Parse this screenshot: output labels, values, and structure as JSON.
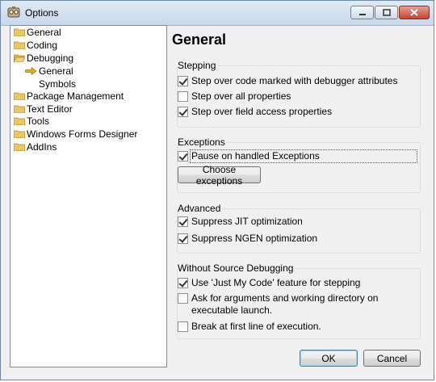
{
  "window": {
    "title": "Options",
    "app_icon": "options-app-icon",
    "controls": [
      "minimize-icon",
      "maximize-icon",
      "close-icon"
    ]
  },
  "tree": {
    "items": [
      {
        "label": "General",
        "icon": "folder-icon"
      },
      {
        "label": "Coding",
        "icon": "folder-icon"
      },
      {
        "label": "Debugging",
        "icon": "folder-open-icon"
      },
      {
        "label": "General",
        "icon": "arrow-right-icon",
        "selected": true
      },
      {
        "label": "Symbols",
        "icon": ""
      },
      {
        "label": "Package Management",
        "icon": "folder-icon"
      },
      {
        "label": "Text Editor",
        "icon": "folder-icon"
      },
      {
        "label": "Tools",
        "icon": "folder-icon"
      },
      {
        "label": "Windows Forms Designer",
        "icon": "folder-icon"
      },
      {
        "label": "AddIns",
        "icon": "folder-icon"
      }
    ]
  },
  "main": {
    "title": "General",
    "stepping": {
      "label": "Stepping",
      "options": [
        {
          "label": "Step over code marked with debugger attributes",
          "checked": true
        },
        {
          "label": "Step over all properties",
          "checked": false
        },
        {
          "label": "Step over field access properties",
          "checked": true
        }
      ]
    },
    "exceptions": {
      "label": "Exceptions",
      "pause": {
        "label": "Pause on handled Exceptions",
        "checked": true
      },
      "choose_button": "Choose exceptions"
    },
    "advanced": {
      "label": "Advanced",
      "options": [
        {
          "label": "Suppress JIT optimization",
          "checked": true
        },
        {
          "label": "Suppress NGEN optimization",
          "checked": true
        }
      ]
    },
    "without_source": {
      "label": "Without Source Debugging",
      "options": [
        {
          "label": "Use 'Just My Code' feature for stepping",
          "checked": true
        },
        {
          "label_line1": "Ask for arguments and working directory on",
          "label_line2": "executable launch.",
          "checked": false
        },
        {
          "label": "Break at first line of execution.",
          "checked": false
        }
      ]
    }
  },
  "footer": {
    "ok_label": "OK",
    "cancel_label": "Cancel"
  },
  "colors": {
    "folder": "#e8c764",
    "arrow": "#d9a400",
    "accent_border": "#3c7fb1"
  }
}
